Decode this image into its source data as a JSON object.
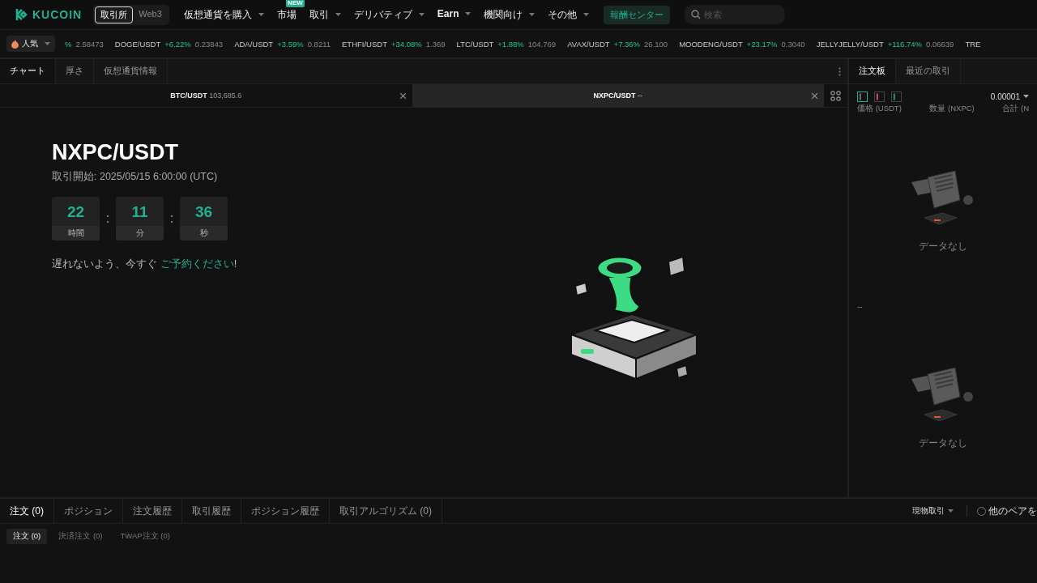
{
  "header": {
    "logo": "KUCOIN",
    "mode_tabs": [
      {
        "label": "取引所",
        "selected": true
      },
      {
        "label": "Web3",
        "selected": false
      }
    ],
    "nav": [
      {
        "label": "仮想通貨を購入",
        "caret": true,
        "bold": false
      },
      {
        "label": "市場",
        "caret": false,
        "badge": "NEW",
        "bold": false
      },
      {
        "label": "取引",
        "caret": true,
        "bold": false
      },
      {
        "label": "デリバティブ",
        "caret": true,
        "bold": false
      },
      {
        "label": "Earn",
        "caret": true,
        "bold": true
      },
      {
        "label": "機関向け",
        "caret": true,
        "bold": false
      },
      {
        "label": "その他",
        "caret": true,
        "bold": false
      }
    ],
    "rewards_button": "報酬センター",
    "search": {
      "placeholder": "検索"
    }
  },
  "ticker": {
    "filter": "人気",
    "items": [
      {
        "change": "%",
        "price": "2.58473"
      },
      {
        "pair": "DOGE/USDT",
        "change": "+6.22%",
        "price": "0.23843"
      },
      {
        "pair": "ADA/USDT",
        "change": "+3.59%",
        "price": "0.8211"
      },
      {
        "pair": "ETHFI/USDT",
        "change": "+34.08%",
        "price": "1.369"
      },
      {
        "pair": "LTC/USDT",
        "change": "+1.88%",
        "price": "104.769"
      },
      {
        "pair": "AVAX/USDT",
        "change": "+7.36%",
        "price": "26.100"
      },
      {
        "pair": "MOODENG/USDT",
        "change": "+23.17%",
        "price": "0.3040"
      },
      {
        "pair": "JELLYJELLY/USDT",
        "change": "+116.74%",
        "price": "0.06639"
      },
      {
        "pair": "TRE"
      }
    ]
  },
  "chart_panel": {
    "tabs": [
      {
        "label": "チャート",
        "selected": true
      },
      {
        "label": "厚さ",
        "selected": false
      },
      {
        "label": "仮想通貨情報",
        "selected": false
      }
    ],
    "chart_tabs": [
      {
        "pair": "BTC/USDT",
        "price": "103,685.6",
        "selected": false
      },
      {
        "pair": "NXPC/USDT",
        "price": "--",
        "selected": true
      }
    ],
    "listing": {
      "title": "NXPC/USDT",
      "start": "取引開始: 2025/05/15 6:00:00 (UTC)",
      "countdown": [
        {
          "value": "22",
          "unit": "時間"
        },
        {
          "value": "11",
          "unit": "分"
        },
        {
          "value": "36",
          "unit": "秒"
        }
      ],
      "separator": ":",
      "message": "遅れないよう、今すぐ",
      "link": "ご予約ください",
      "end": "!"
    }
  },
  "order_book": {
    "tabs": [
      {
        "label": "注文板",
        "selected": true
      },
      {
        "label": "最近の取引",
        "selected": false
      }
    ],
    "views": [
      {
        "kind": "both",
        "selected": true
      },
      {
        "kind": "asks",
        "selected": false
      },
      {
        "kind": "bids",
        "selected": false
      }
    ],
    "precision": "0.00001",
    "columns": [
      "価格 (USDT)",
      "数量 (NXPC)",
      "合計 (N"
    ],
    "asks_empty": "データなし",
    "mid_price": "--",
    "bids_empty": "データなし"
  },
  "orders_panel": {
    "tabs": [
      {
        "label": "注文 (0)",
        "selected": true
      },
      {
        "label": "ポジション",
        "selected": false
      },
      {
        "label": "注文履歴",
        "selected": false
      },
      {
        "label": "取引履歴",
        "selected": false
      },
      {
        "label": "ポジション履歴",
        "selected": false
      },
      {
        "label": "取引アルゴリズム (0)",
        "selected": false
      }
    ],
    "market_filter": "現物取引",
    "other_pairs": {
      "label": "他のペアを",
      "checked": false
    },
    "sub_tabs": [
      {
        "label": "注文 (0)",
        "selected": true
      },
      {
        "label": "決済注文 (0)",
        "selected": false
      },
      {
        "label": "TWAP注文 (0)",
        "selected": false
      }
    ]
  }
}
